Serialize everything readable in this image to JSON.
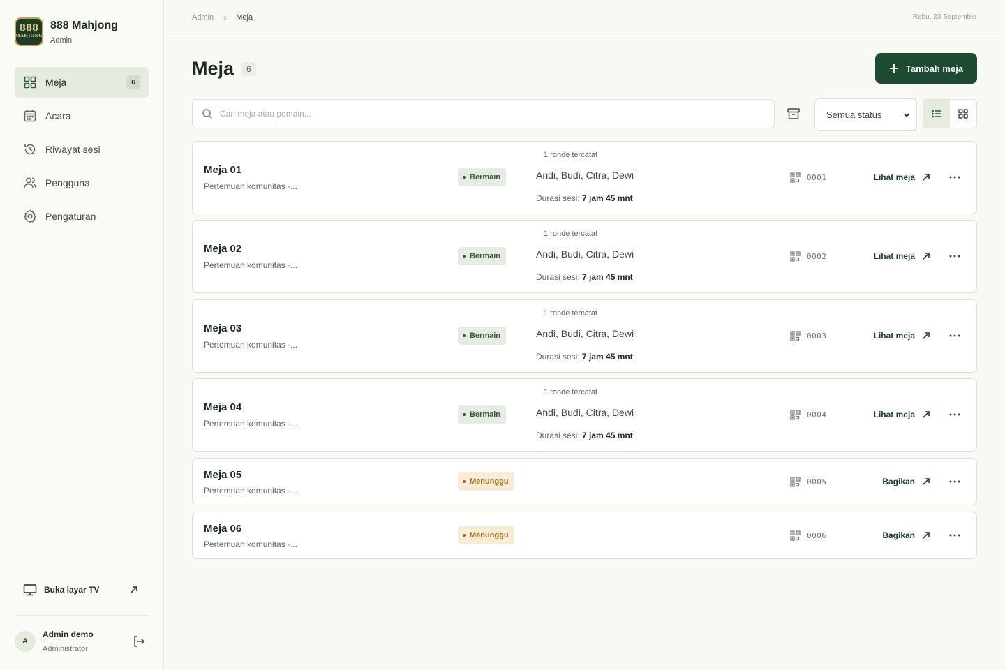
{
  "brand": {
    "name": "888 Mahjong",
    "role": "Admin",
    "logo_top": "888",
    "logo_bottom": "MAHJONG"
  },
  "nav": [
    {
      "label": "Meja",
      "icon": "grid-icon",
      "badge": "6",
      "active": true
    },
    {
      "label": "Acara",
      "icon": "calendar-icon"
    },
    {
      "label": "Riwayat sesi",
      "icon": "history-icon"
    },
    {
      "label": "Pengguna",
      "icon": "users-icon"
    },
    {
      "label": "Pengaturan",
      "icon": "gear-icon"
    }
  ],
  "tv_link": {
    "label": "Buka layar TV"
  },
  "user": {
    "initial": "A",
    "name": "Admin demo",
    "role": "Administrator"
  },
  "breadcrumb": {
    "root": "Admin",
    "current": "Meja"
  },
  "date": "Rabu, 23 September",
  "page": {
    "title": "Meja",
    "count": "6",
    "add_label": "Tambah meja"
  },
  "search": {
    "placeholder": "Cari meja atau pemain...",
    "value": ""
  },
  "filter": {
    "selected": "Semua status"
  },
  "tables": [
    {
      "name": "Meja 01",
      "desc": "Pertemuan komunitas ·...",
      "status": "Bermain",
      "rounds": "1 ronde tercatat",
      "players": "Andi, Budi, Citra, Dewi",
      "duration_label": "Durasi sesi:",
      "duration": "7 jam 45 mnt",
      "code": "0001",
      "action": "Lihat meja"
    },
    {
      "name": "Meja 02",
      "desc": "Pertemuan komunitas ·...",
      "status": "Bermain",
      "rounds": "1 ronde tercatat",
      "players": "Andi, Budi, Citra, Dewi",
      "duration_label": "Durasi sesi:",
      "duration": "7 jam 45 mnt",
      "code": "0002",
      "action": "Lihat meja"
    },
    {
      "name": "Meja 03",
      "desc": "Pertemuan komunitas ·...",
      "status": "Bermain",
      "rounds": "1 ronde tercatat",
      "players": "Andi, Budi, Citra, Dewi",
      "duration_label": "Durasi sesi:",
      "duration": "7 jam 45 mnt",
      "code": "0003",
      "action": "Lihat meja"
    },
    {
      "name": "Meja 04",
      "desc": "Pertemuan komunitas ·...",
      "status": "Bermain",
      "rounds": "1 ronde tercatat",
      "players": "Andi, Budi, Citra, Dewi",
      "duration_label": "Durasi sesi:",
      "duration": "7 jam 45 mnt",
      "code": "0004",
      "action": "Lihat meja"
    },
    {
      "name": "Meja 05",
      "desc": "Pertemuan komunitas ·...",
      "status": "Menunggu",
      "code": "0005",
      "action": "Bagikan"
    },
    {
      "name": "Meja 06",
      "desc": "Pertemuan komunitas ·...",
      "status": "Menunggu",
      "code": "0006",
      "action": "Bagikan"
    }
  ],
  "colors": {
    "primary": "#1d4a33",
    "playing_bg": "#e6ece1",
    "waiting_bg": "#f8ebd8",
    "waiting_fg": "#9a6b1f"
  }
}
